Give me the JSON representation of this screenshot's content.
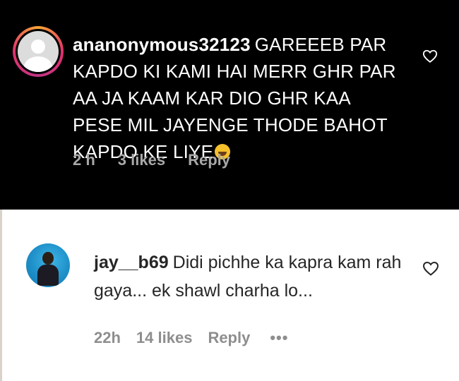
{
  "top_comment": {
    "username": "ananonymous32123",
    "text": "GAREEEB PAR KAPDO KI KAMI HAI MERR GHR PAR AA JA KAAM KAR DIO GHR KAA PESE MIL JAYENGE THODE BAHOT KAPDO KE LIYE",
    "emoji": "laughing-face",
    "time": "2 h",
    "likes": "3 likes",
    "reply_label": "Reply",
    "heart_icon": "heart-outline-icon"
  },
  "bottom_comment": {
    "username": "jay__b69",
    "text": "Didi pichhe ka kapra kam rah gaya... ek shawl charha lo...",
    "time": "22h",
    "likes": "14 likes",
    "reply_label": "Reply",
    "more_label": "•••",
    "heart_icon": "heart-outline-icon"
  },
  "colors": {
    "top_background": "#000000",
    "top_text": "#ffffff",
    "top_meta": "#a8a8a8",
    "bottom_background": "#ffffff",
    "bottom_text": "#262626",
    "bottom_meta": "#8e8e8e"
  }
}
